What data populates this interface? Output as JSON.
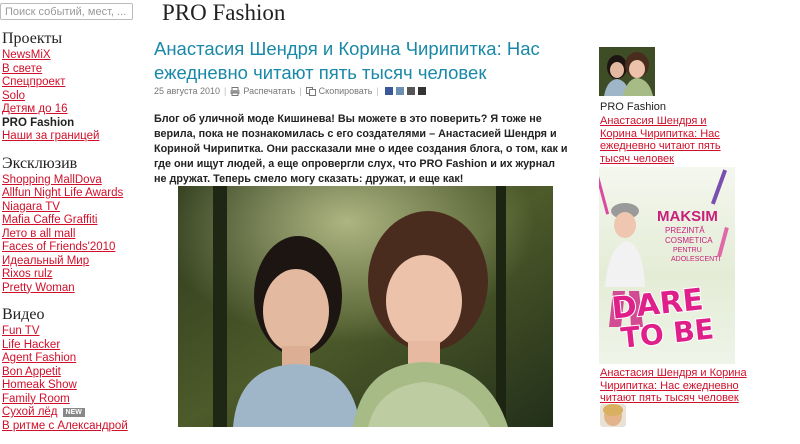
{
  "search": {
    "placeholder": "Поиск событий, мест, ..."
  },
  "site_title": "PRO Fashion",
  "sidebar": {
    "sections": [
      {
        "title": "Проекты",
        "items": [
          "NewsMiX",
          "В свете",
          "Спецпроект",
          "Solo",
          "Детям до 16",
          "PRO Fashion",
          "Наши за границей"
        ]
      },
      {
        "title": "Эксклюзив",
        "items": [
          "Shopping MallDova",
          "Allfun Night Life Awards",
          "Niagara TV",
          "Mafia Caffe Graffiti",
          "Лето в all mall",
          "Faces of Friends'2010",
          "Идеальный Мир",
          "Rixos rulz",
          "Pretty Woman"
        ]
      },
      {
        "title": "Видео",
        "items": [
          "Fun TV",
          "Life Hacker",
          "Agent Fashion",
          "Bon Appetit",
          "Homeak Show",
          "Family Room",
          "Сухой лёд",
          "В ритме с Александрой"
        ]
      }
    ],
    "active_item": "PRO Fashion",
    "new_badge": "NEW"
  },
  "article": {
    "title": "Анастасия Шендря и Корина Чирипитка: Нас ежедневно читают пять тысяч человек",
    "date": "25 августа 2010",
    "print_label": "Распечатать",
    "copy_label": "Скопировать",
    "lead": "Блог об уличной моде Кишинева! Вы можете в это поверить? Я тоже не верила, пока не познакомилась с его создателями – Анастасией Шендря и Кориной Чирипитка. Они рассказали мне о идее создания блога, о том, как и где они ищут людей, а еще опровергли слух, что PRO Fashion и их журнал не дружат. Теперь смело могу сказать: дружат, и еще как!"
  },
  "right": {
    "section_title": "PRO Fashion",
    "link": "Анастасия Шендря и Корина Чирипитка: Нас ежедневно читают пять тысяч человек",
    "ad": {
      "brand": "MAKSIM",
      "line1": "PREZINTĂ",
      "line2": "COSMETICA",
      "line3": "PENTRU",
      "line4": "ADOLESCENTI",
      "slogan1": "DARE",
      "slogan2": "TO BE"
    },
    "ad_caption": "Анастасия Шендря и Корина Чирипитка: Нас ежедневно читают пять тысяч человек"
  },
  "colors": {
    "link": "#d0102b",
    "title": "#1a88a8",
    "text": "#222222"
  },
  "icons": [
    "printer-icon",
    "copy-icon",
    "facebook-icon",
    "twitter-icon",
    "odnoklassniki-icon",
    "vkontakte-icon"
  ]
}
